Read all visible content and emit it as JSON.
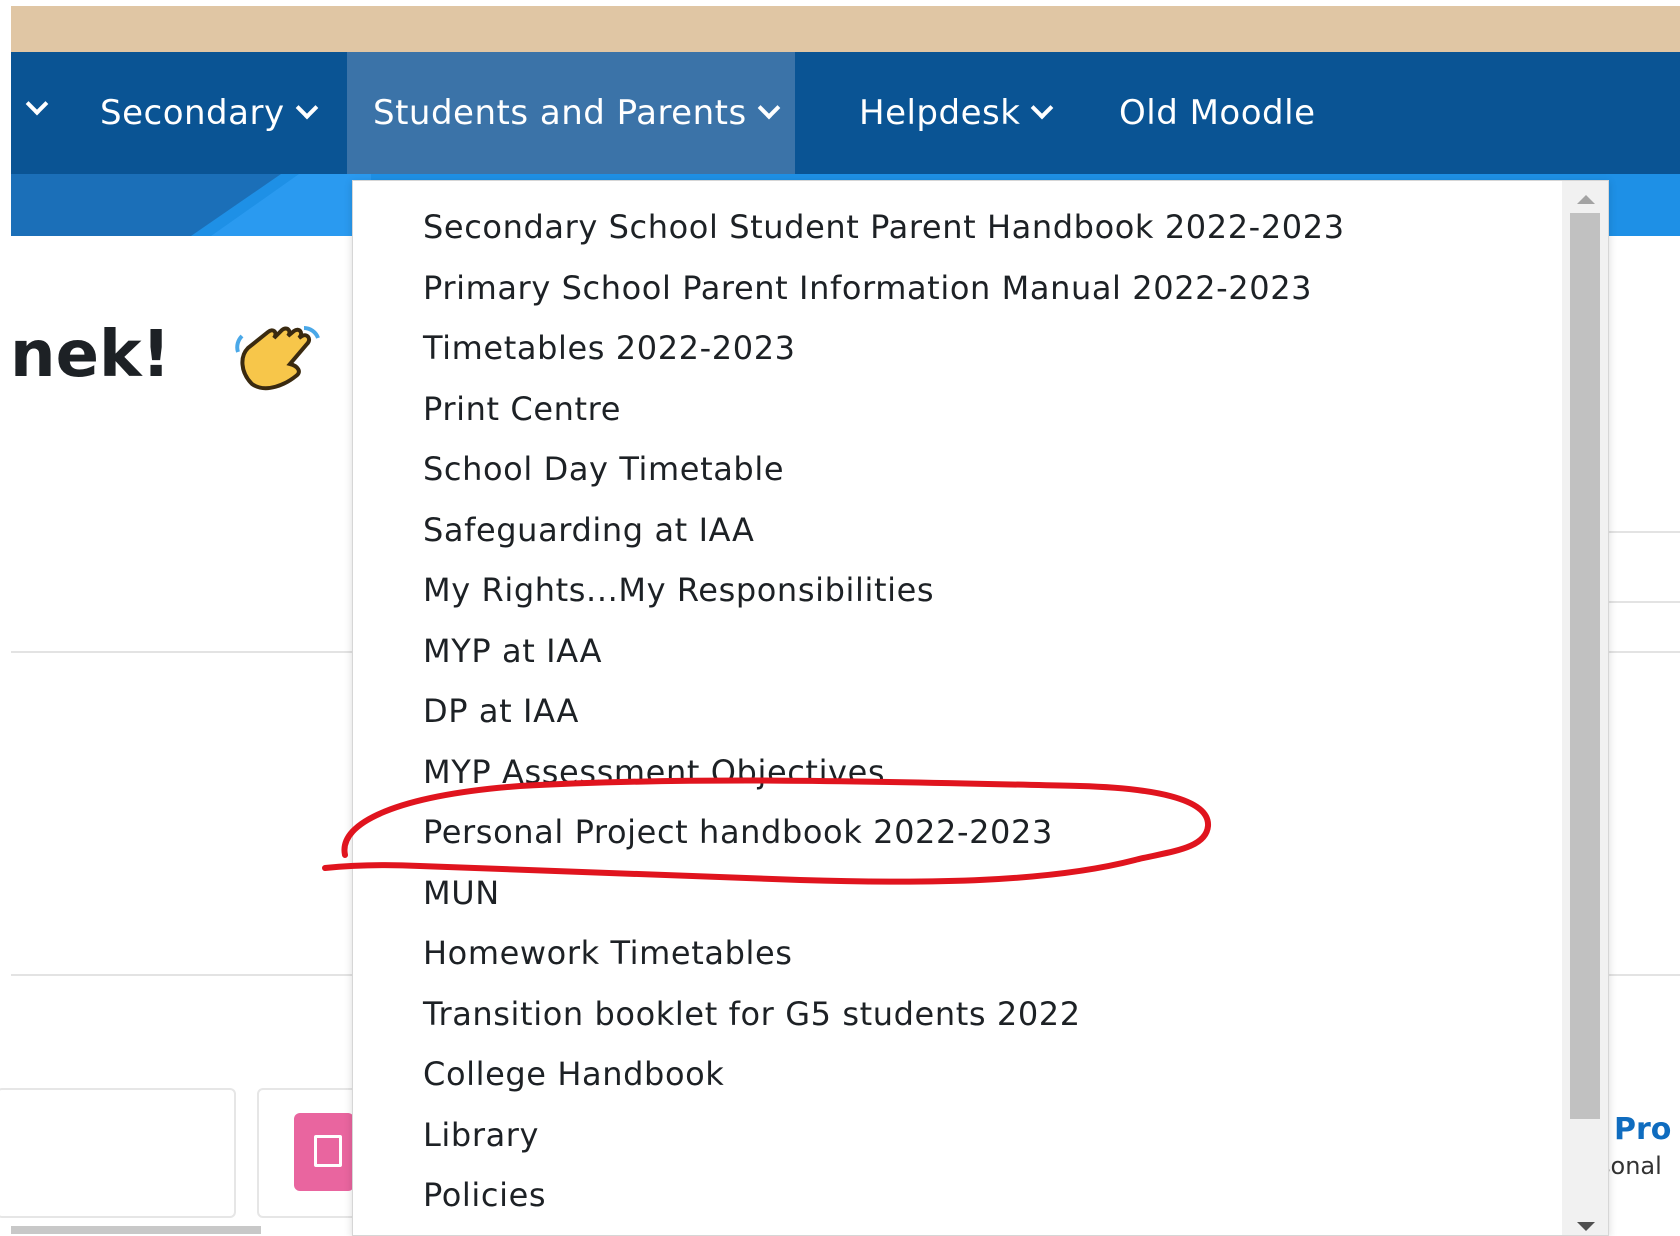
{
  "navbar": {
    "items": [
      {
        "label": "Secondary",
        "has_dropdown": true
      },
      {
        "label": "Students and Parents",
        "has_dropdown": true,
        "active": true
      },
      {
        "label": "Helpdesk",
        "has_dropdown": true
      },
      {
        "label": "Old Moodle",
        "has_dropdown": false
      }
    ]
  },
  "page": {
    "greeting": "nek!",
    "greeting_icon": "waving-hand-emoji",
    "right_card_title": "Pro",
    "right_card_subtitle": "sonal"
  },
  "dropdown": {
    "items": [
      "Secondary School Student Parent Handbook 2022-2023",
      "Primary School Parent Information Manual 2022-2023",
      "Timetables 2022-2023",
      "Print Centre",
      "School Day Timetable",
      "Safeguarding at IAA",
      "My Rights...My Responsibilities",
      "MYP at IAA",
      "DP at IAA",
      "MYP Assessment Objectives",
      "Personal Project handbook 2022-2023",
      "MUN",
      "Homework Timetables",
      "Transition booklet for G5 students 2022",
      "College Handbook",
      "Library",
      "Policies"
    ],
    "highlighted_item": "Personal Project handbook 2022-2023"
  },
  "colors": {
    "top_bar": "#e0c6a4",
    "navbar": "#0a5494",
    "navbar_active": "#3b73a8",
    "hero": "#1e90e6",
    "annotation_red": "#e0141e",
    "accent_pink": "#e9659f",
    "link_blue": "#0f6cbf"
  }
}
